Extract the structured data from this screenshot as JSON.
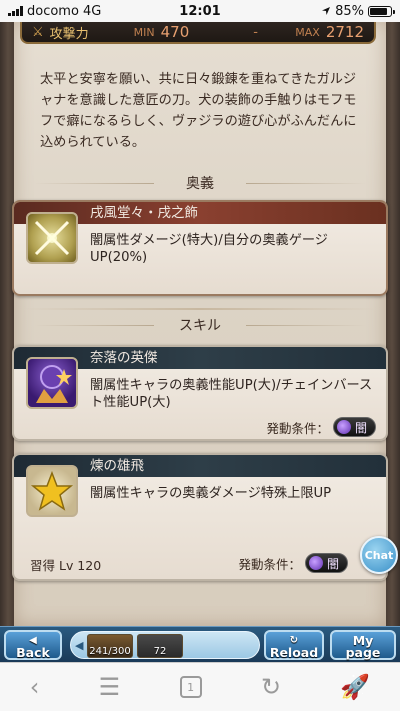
{
  "status": {
    "carrier": "docomo",
    "network": "4G",
    "time": "12:01",
    "battery": "85%",
    "battery_level": 0.85
  },
  "weapon": {
    "atk_label": "攻撃力",
    "min_label": "MIN",
    "min_value": "470",
    "separator": "-",
    "max_label": "MAX",
    "max_value": "2712",
    "description": "太平と安寧を願い、共に日々鍛錬を重ねてきたガルジャナを意識した意匠の刀。犬の装飾の手触りはモフモフで癖になるらしく、ヴァジラの遊び心がふんだんに込められている。"
  },
  "ougi_section": {
    "heading": "奥義",
    "name": "戌風堂々・戌之飾",
    "text": "闇属性ダメージ(特大)/自分の奥義ゲージUP(20%)"
  },
  "skill_section": {
    "heading": "スキル",
    "skills": [
      {
        "name": "奈落の英傑",
        "text": "闇属性キャラの奥義性能UP(大)/チェインバースト性能UP(大)",
        "condition_label": "発動条件：",
        "condition_value": "闇"
      },
      {
        "name": "煉の雄飛",
        "text": "闇属性キャラの奥義ダメージ特殊上限UP",
        "learn_label": "習得 Lv 120",
        "condition_label": "発動条件：",
        "condition_value": "闇"
      }
    ]
  },
  "chat_button": "Chat",
  "game_bar": {
    "back": "Back",
    "reload": "Reload",
    "mypage_top": "My",
    "mypage_bottom": "page",
    "item1_count": "241/300",
    "item2_count": "72"
  },
  "browser": {
    "tab_count": "1"
  },
  "colors": {
    "ougi_bar": "#8a4030",
    "skill_bar": "#2e3e48",
    "nav_button": "#3a80b8"
  }
}
